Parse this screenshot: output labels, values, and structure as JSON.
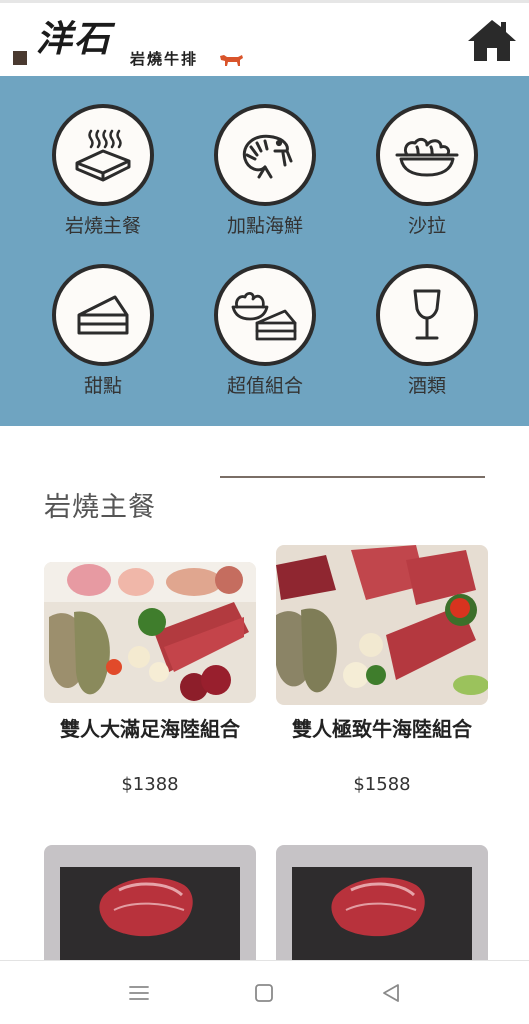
{
  "header": {
    "logo_mark": "洋石",
    "logo_sub": "岩燒牛排",
    "home_icon": "home-icon"
  },
  "categories": [
    {
      "label": "岩燒主餐",
      "icon": "sizzling-stone-icon"
    },
    {
      "label": "加點海鮮",
      "icon": "shrimp-icon"
    },
    {
      "label": "沙拉",
      "icon": "salad-bowl-icon"
    },
    {
      "label": "甜點",
      "icon": "cake-slice-icon"
    },
    {
      "label": "超值組合",
      "icon": "combo-set-icon"
    },
    {
      "label": "酒類",
      "icon": "wine-glass-icon"
    }
  ],
  "section": {
    "title": "岩燒主餐"
  },
  "products": [
    {
      "name": "雙人大滿足海陸組合",
      "price": "$1388"
    },
    {
      "name": "雙人極致牛海陸組合",
      "price": "$1588"
    },
    {
      "name": "",
      "price": ""
    },
    {
      "name": "",
      "price": ""
    }
  ],
  "nav": {
    "menu_icon": "menu-icon",
    "home_icon": "square-home-icon",
    "back_icon": "back-triangle-icon"
  },
  "colors": {
    "category_bg": "#6fa4c1",
    "icon_stroke": "#2c2c2c",
    "circle_fill": "#fdfbf8"
  }
}
